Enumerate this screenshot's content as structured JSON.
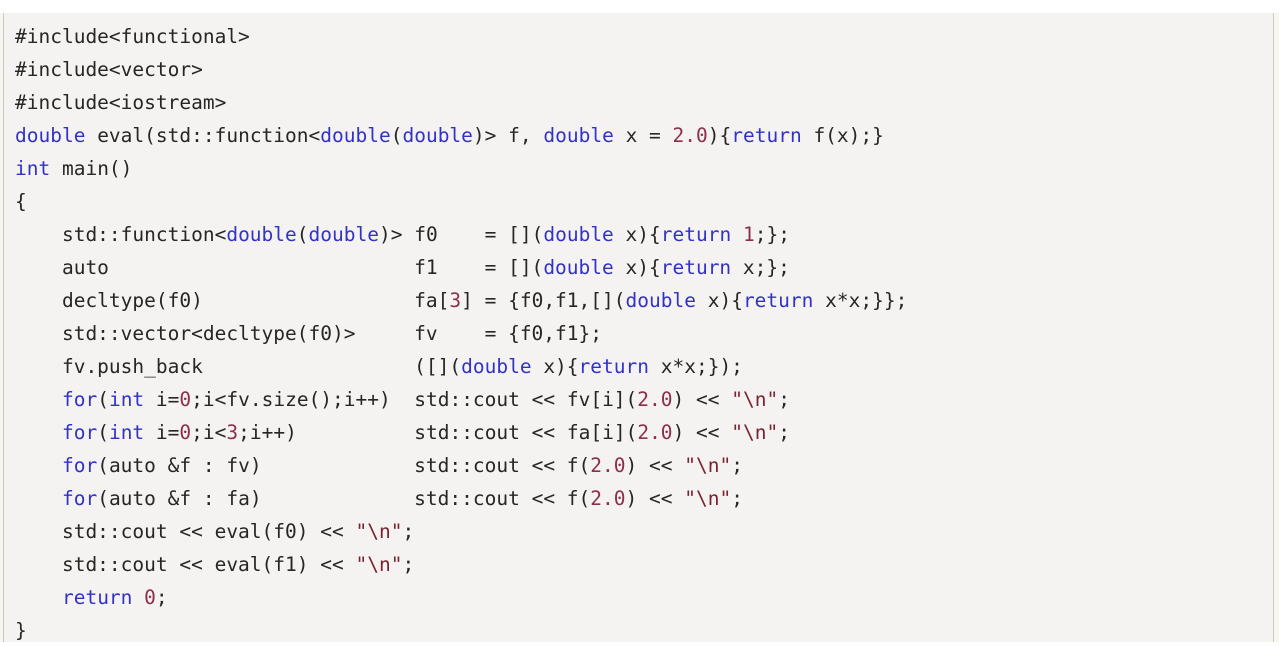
{
  "code_block": {
    "language": "cpp",
    "background_color": "#f4f3f1",
    "border_color": "#c9c9c9",
    "edge_color": "#f7f6ee",
    "colors": {
      "plain": "#262626",
      "keyword": "#3232c8",
      "number": "#8c2f4a",
      "string": "#7a2230"
    },
    "plain_text": "#include<functional>\n#include<vector>\n#include<iostream>\ndouble eval(std::function<double(double)> f, double x = 2.0){return f(x);}\nint main()\n{\n    std::function<double(double)> f0    = [](double x){return 1;};\n    auto                          f1    = [](double x){return x;};\n    decltype(f0)                  fa[3] = {f0,f1,[](double x){return x*x;}};\n    std::vector<decltype(f0)>     fv    = {f0,f1};\n    fv.push_back                  ([](double x){return x*x;});\n    for(int i=0;i<fv.size();i++)  std::cout << fv[i](2.0) << \"\\n\";\n    for(int i=0;i<3;i++)          std::cout << fa[i](2.0) << \"\\n\";\n    for(auto &f : fv)             std::cout << f(2.0) << \"\\n\";\n    for(auto &f : fa)             std::cout << f(2.0) << \"\\n\";\n    std::cout << eval(f0) << \"\\n\";\n    std::cout << eval(f1) << \"\\n\";\n    return 0;\n}",
    "lines": [
      {
        "n": 1,
        "tokens": [
          {
            "t": "plain",
            "v": "#include<functional>"
          }
        ]
      },
      {
        "n": 2,
        "tokens": [
          {
            "t": "plain",
            "v": "#include<vector>"
          }
        ]
      },
      {
        "n": 3,
        "tokens": [
          {
            "t": "plain",
            "v": "#include<iostream>"
          }
        ]
      },
      {
        "n": 4,
        "tokens": [
          {
            "t": "kw",
            "v": "double"
          },
          {
            "t": "plain",
            "v": " eval(std::function<"
          },
          {
            "t": "kw",
            "v": "double"
          },
          {
            "t": "plain",
            "v": "("
          },
          {
            "t": "kw",
            "v": "double"
          },
          {
            "t": "plain",
            "v": ")> f, "
          },
          {
            "t": "kw",
            "v": "double"
          },
          {
            "t": "plain",
            "v": " x = "
          },
          {
            "t": "num",
            "v": "2.0"
          },
          {
            "t": "plain",
            "v": "){"
          },
          {
            "t": "kw",
            "v": "return"
          },
          {
            "t": "plain",
            "v": " f(x);}"
          }
        ]
      },
      {
        "n": 5,
        "tokens": [
          {
            "t": "kw",
            "v": "int"
          },
          {
            "t": "plain",
            "v": " main()"
          }
        ]
      },
      {
        "n": 6,
        "tokens": [
          {
            "t": "plain",
            "v": "{"
          }
        ]
      },
      {
        "n": 7,
        "tokens": [
          {
            "t": "plain",
            "v": "    std::function<"
          },
          {
            "t": "kw",
            "v": "double"
          },
          {
            "t": "plain",
            "v": "("
          },
          {
            "t": "kw",
            "v": "double"
          },
          {
            "t": "plain",
            "v": ")> f0    = []("
          },
          {
            "t": "kw",
            "v": "double"
          },
          {
            "t": "plain",
            "v": " x){"
          },
          {
            "t": "kw",
            "v": "return"
          },
          {
            "t": "plain",
            "v": " "
          },
          {
            "t": "num",
            "v": "1"
          },
          {
            "t": "plain",
            "v": ";};"
          }
        ]
      },
      {
        "n": 8,
        "tokens": [
          {
            "t": "plain",
            "v": "    auto                          f1    = []("
          },
          {
            "t": "kw",
            "v": "double"
          },
          {
            "t": "plain",
            "v": " x){"
          },
          {
            "t": "kw",
            "v": "return"
          },
          {
            "t": "plain",
            "v": " x;};"
          }
        ]
      },
      {
        "n": 9,
        "tokens": [
          {
            "t": "plain",
            "v": "    decltype(f0)                  fa["
          },
          {
            "t": "num",
            "v": "3"
          },
          {
            "t": "plain",
            "v": "] = {f0,f1,[]("
          },
          {
            "t": "kw",
            "v": "double"
          },
          {
            "t": "plain",
            "v": " x){"
          },
          {
            "t": "kw",
            "v": "return"
          },
          {
            "t": "plain",
            "v": " x*x;}};"
          }
        ]
      },
      {
        "n": 10,
        "tokens": [
          {
            "t": "plain",
            "v": "    std::vector<decltype(f0)>     fv    = {f0,f1};"
          }
        ]
      },
      {
        "n": 11,
        "tokens": [
          {
            "t": "plain",
            "v": "    fv.push_back                  ([]("
          },
          {
            "t": "kw",
            "v": "double"
          },
          {
            "t": "plain",
            "v": " x){"
          },
          {
            "t": "kw",
            "v": "return"
          },
          {
            "t": "plain",
            "v": " x*x;});"
          }
        ]
      },
      {
        "n": 12,
        "tokens": [
          {
            "t": "plain",
            "v": "    "
          },
          {
            "t": "kw",
            "v": "for"
          },
          {
            "t": "plain",
            "v": "("
          },
          {
            "t": "kw",
            "v": "int"
          },
          {
            "t": "plain",
            "v": " i="
          },
          {
            "t": "num",
            "v": "0"
          },
          {
            "t": "plain",
            "v": ";i<fv.size();i++)  std::cout << fv[i]("
          },
          {
            "t": "num",
            "v": "2.0"
          },
          {
            "t": "plain",
            "v": ") << "
          },
          {
            "t": "str",
            "v": "\"\\n\""
          },
          {
            "t": "plain",
            "v": ";"
          }
        ]
      },
      {
        "n": 13,
        "tokens": [
          {
            "t": "plain",
            "v": "    "
          },
          {
            "t": "kw",
            "v": "for"
          },
          {
            "t": "plain",
            "v": "("
          },
          {
            "t": "kw",
            "v": "int"
          },
          {
            "t": "plain",
            "v": " i="
          },
          {
            "t": "num",
            "v": "0"
          },
          {
            "t": "plain",
            "v": ";i<"
          },
          {
            "t": "num",
            "v": "3"
          },
          {
            "t": "plain",
            "v": ";i++)          std::cout << fa[i]("
          },
          {
            "t": "num",
            "v": "2.0"
          },
          {
            "t": "plain",
            "v": ") << "
          },
          {
            "t": "str",
            "v": "\"\\n\""
          },
          {
            "t": "plain",
            "v": ";"
          }
        ]
      },
      {
        "n": 14,
        "tokens": [
          {
            "t": "plain",
            "v": "    "
          },
          {
            "t": "kw",
            "v": "for"
          },
          {
            "t": "plain",
            "v": "(auto &f : fv)             std::cout << f("
          },
          {
            "t": "num",
            "v": "2.0"
          },
          {
            "t": "plain",
            "v": ") << "
          },
          {
            "t": "str",
            "v": "\"\\n\""
          },
          {
            "t": "plain",
            "v": ";"
          }
        ]
      },
      {
        "n": 15,
        "tokens": [
          {
            "t": "plain",
            "v": "    "
          },
          {
            "t": "kw",
            "v": "for"
          },
          {
            "t": "plain",
            "v": "(auto &f : fa)             std::cout << f("
          },
          {
            "t": "num",
            "v": "2.0"
          },
          {
            "t": "plain",
            "v": ") << "
          },
          {
            "t": "str",
            "v": "\"\\n\""
          },
          {
            "t": "plain",
            "v": ";"
          }
        ]
      },
      {
        "n": 16,
        "tokens": [
          {
            "t": "plain",
            "v": "    std::cout << eval(f0) << "
          },
          {
            "t": "str",
            "v": "\"\\n\""
          },
          {
            "t": "plain",
            "v": ";"
          }
        ]
      },
      {
        "n": 17,
        "tokens": [
          {
            "t": "plain",
            "v": "    std::cout << eval(f1) << "
          },
          {
            "t": "str",
            "v": "\"\\n\""
          },
          {
            "t": "plain",
            "v": ";"
          }
        ]
      },
      {
        "n": 18,
        "tokens": [
          {
            "t": "plain",
            "v": "    "
          },
          {
            "t": "kw",
            "v": "return"
          },
          {
            "t": "plain",
            "v": " "
          },
          {
            "t": "num",
            "v": "0"
          },
          {
            "t": "plain",
            "v": ";"
          }
        ]
      },
      {
        "n": 19,
        "tokens": [
          {
            "t": "plain",
            "v": "}"
          }
        ]
      }
    ]
  }
}
